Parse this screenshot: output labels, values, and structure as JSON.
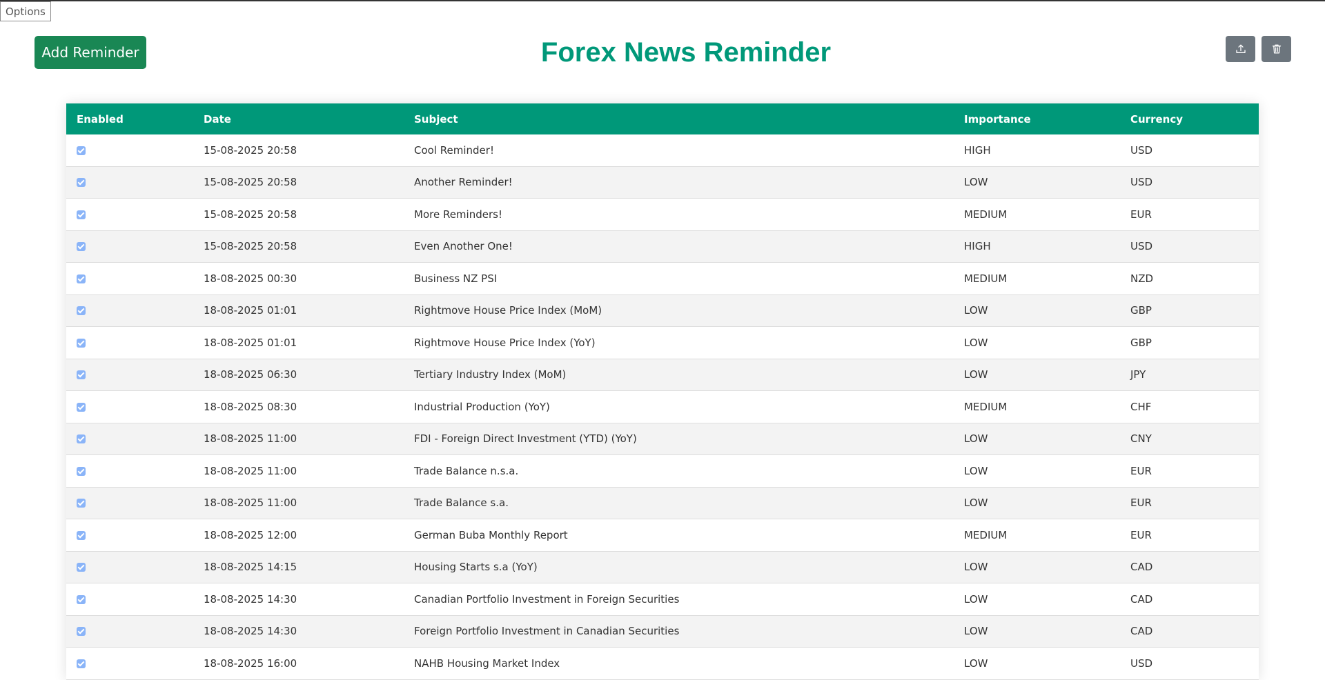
{
  "options_label": "Options",
  "add_button_label": "Add Reminder",
  "title": "Forex News Reminder",
  "icons": {
    "export": "upload-icon",
    "delete": "trash-icon"
  },
  "colors": {
    "accent": "#009879",
    "add_button": "#198754",
    "icon_button": "#6c757d",
    "checkbox": "#8ab4f8"
  },
  "table": {
    "headers": [
      "Enabled",
      "Date",
      "Subject",
      "Importance",
      "Currency"
    ],
    "rows": [
      {
        "enabled": true,
        "date": "15-08-2025 20:58",
        "subject": "Cool Reminder!",
        "importance": "HIGH",
        "currency": "USD"
      },
      {
        "enabled": true,
        "date": "15-08-2025 20:58",
        "subject": "Another Reminder!",
        "importance": "LOW",
        "currency": "USD"
      },
      {
        "enabled": true,
        "date": "15-08-2025 20:58",
        "subject": "More Reminders!",
        "importance": "MEDIUM",
        "currency": "EUR"
      },
      {
        "enabled": true,
        "date": "15-08-2025 20:58",
        "subject": "Even Another One!",
        "importance": "HIGH",
        "currency": "USD"
      },
      {
        "enabled": true,
        "date": "18-08-2025 00:30",
        "subject": "Business NZ PSI",
        "importance": "MEDIUM",
        "currency": "NZD"
      },
      {
        "enabled": true,
        "date": "18-08-2025 01:01",
        "subject": "Rightmove House Price Index (MoM)",
        "importance": "LOW",
        "currency": "GBP"
      },
      {
        "enabled": true,
        "date": "18-08-2025 01:01",
        "subject": "Rightmove House Price Index (YoY)",
        "importance": "LOW",
        "currency": "GBP"
      },
      {
        "enabled": true,
        "date": "18-08-2025 06:30",
        "subject": "Tertiary Industry Index (MoM)",
        "importance": "LOW",
        "currency": "JPY"
      },
      {
        "enabled": true,
        "date": "18-08-2025 08:30",
        "subject": "Industrial Production (YoY)",
        "importance": "MEDIUM",
        "currency": "CHF"
      },
      {
        "enabled": true,
        "date": "18-08-2025 11:00",
        "subject": "FDI - Foreign Direct Investment (YTD) (YoY)",
        "importance": "LOW",
        "currency": "CNY"
      },
      {
        "enabled": true,
        "date": "18-08-2025 11:00",
        "subject": "Trade Balance n.s.a.",
        "importance": "LOW",
        "currency": "EUR"
      },
      {
        "enabled": true,
        "date": "18-08-2025 11:00",
        "subject": "Trade Balance s.a.",
        "importance": "LOW",
        "currency": "EUR"
      },
      {
        "enabled": true,
        "date": "18-08-2025 12:00",
        "subject": "German Buba Monthly Report",
        "importance": "MEDIUM",
        "currency": "EUR"
      },
      {
        "enabled": true,
        "date": "18-08-2025 14:15",
        "subject": "Housing Starts s.a (YoY)",
        "importance": "LOW",
        "currency": "CAD"
      },
      {
        "enabled": true,
        "date": "18-08-2025 14:30",
        "subject": "Canadian Portfolio Investment in Foreign Securities",
        "importance": "LOW",
        "currency": "CAD"
      },
      {
        "enabled": true,
        "date": "18-08-2025 14:30",
        "subject": "Foreign Portfolio Investment in Canadian Securities",
        "importance": "LOW",
        "currency": "CAD"
      },
      {
        "enabled": true,
        "date": "18-08-2025 16:00",
        "subject": "NAHB Housing Market Index",
        "importance": "LOW",
        "currency": "USD"
      }
    ]
  }
}
